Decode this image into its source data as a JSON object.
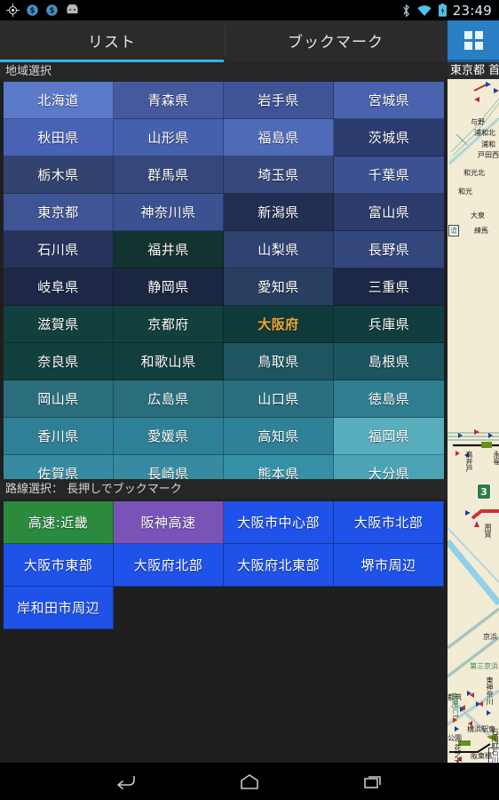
{
  "statusbar": {
    "time": "23:49",
    "left_icons": [
      "gps-crosshair-icon",
      "currency-dollar-icon",
      "currency-dollar-icon",
      "android-robot-icon"
    ],
    "right_icons": [
      "bluetooth-icon",
      "wifi-icon",
      "battery-charging-icon"
    ]
  },
  "tabs": [
    {
      "label": "リスト",
      "active": true
    },
    {
      "label": "ブックマーク",
      "active": false
    }
  ],
  "toolbar": {
    "grid_view_icon": "grid-view-icon",
    "accent": "#33b5e5",
    "button_bg": "#2a7fc4"
  },
  "region_section": {
    "label": "地域選択"
  },
  "route_section": {
    "label": "路線選択： 長押しでブックマーク"
  },
  "prefectures": [
    {
      "label": "北海道",
      "bg": "#5b79c9"
    },
    {
      "label": "青森県",
      "bg": "#44599e"
    },
    {
      "label": "岩手県",
      "bg": "#3f5496"
    },
    {
      "label": "宮城県",
      "bg": "#4a63ae"
    },
    {
      "label": "秋田県",
      "bg": "#4863b4"
    },
    {
      "label": "山形県",
      "bg": "#4561ad"
    },
    {
      "label": "福島県",
      "bg": "#4f6bb8"
    },
    {
      "label": "茨城県",
      "bg": "#2c3c6e"
    },
    {
      "label": "栃木県",
      "bg": "#33436f"
    },
    {
      "label": "群馬県",
      "bg": "#35477b"
    },
    {
      "label": "埼玉県",
      "bg": "#36487c"
    },
    {
      "label": "千葉県",
      "bg": "#3b5192"
    },
    {
      "label": "東京都",
      "bg": "#3e5494"
    },
    {
      "label": "神奈川県",
      "bg": "#3b5190"
    },
    {
      "label": "新潟県",
      "bg": "#232f52"
    },
    {
      "label": "富山県",
      "bg": "#2d3c6c"
    },
    {
      "label": "石川県",
      "bg": "#27335a"
    },
    {
      "label": "福井県",
      "bg": "#12332f"
    },
    {
      "label": "山梨県",
      "bg": "#2f4271"
    },
    {
      "label": "長野県",
      "bg": "#33477d"
    },
    {
      "label": "岐阜県",
      "bg": "#1e2746"
    },
    {
      "label": "静岡県",
      "bg": "#1b2640"
    },
    {
      "label": "愛知県",
      "bg": "#283f62"
    },
    {
      "label": "三重県",
      "bg": "#1d2746"
    },
    {
      "label": "滋賀県",
      "bg": "#12403f"
    },
    {
      "label": "京都府",
      "bg": "#11403e"
    },
    {
      "label": "大阪府",
      "bg": "#0f3a3a",
      "selected": true
    },
    {
      "label": "兵庫県",
      "bg": "#123d3e"
    },
    {
      "label": "奈良県",
      "bg": "#11403f"
    },
    {
      "label": "和歌山県",
      "bg": "#123f3d"
    },
    {
      "label": "鳥取県",
      "bg": "#1d5660"
    },
    {
      "label": "島根県",
      "bg": "#1b5560"
    },
    {
      "label": "岡山県",
      "bg": "#2b6e7d"
    },
    {
      "label": "広島県",
      "bg": "#2a6e7e"
    },
    {
      "label": "山口県",
      "bg": "#2a6f80"
    },
    {
      "label": "徳島県",
      "bg": "#2f7e90"
    },
    {
      "label": "香川県",
      "bg": "#2f8096"
    },
    {
      "label": "愛媛県",
      "bg": "#2e8096"
    },
    {
      "label": "高知県",
      "bg": "#2e8197"
    },
    {
      "label": "福岡県",
      "bg": "#59aebd"
    },
    {
      "label": "佐賀県",
      "bg": "#368ba0"
    },
    {
      "label": "長崎県",
      "bg": "#368ba0"
    },
    {
      "label": "熊本県",
      "bg": "#3590a5"
    },
    {
      "label": "大分県",
      "bg": "#4ba4b6"
    }
  ],
  "routes": [
    {
      "label": "高速:近畿",
      "bg": "#2b8a3e"
    },
    {
      "label": "阪神高速",
      "bg": "#7a53b8"
    },
    {
      "label": "大阪市中心部",
      "bg": "#1f52e8"
    },
    {
      "label": "大阪市北部",
      "bg": "#1f52e8"
    },
    {
      "label": "大阪市東部",
      "bg": "#1f52e8"
    },
    {
      "label": "大阪府北部",
      "bg": "#1f52e8"
    },
    {
      "label": "大阪府北東部",
      "bg": "#1f52e8"
    },
    {
      "label": "堺市周辺",
      "bg": "#1f52e8"
    },
    {
      "label": "岸和田市周辺",
      "bg": "#1f52e8"
    }
  ],
  "map_panel": {
    "title": "東京都 首",
    "route_shield": "3",
    "labels": [
      "与野",
      "浦和北",
      "浦和",
      "戸田西",
      "和光北",
      "和光",
      "大泉",
      "練馬",
      "高井戸",
      "永福",
      "用賀",
      "京浜",
      "第三京浜",
      "都筑",
      "東神奈川",
      "金港JCT",
      "横浜駅東",
      "石川町",
      "石川町JCT",
      "阪東橋",
      "花之木",
      "公園"
    ]
  },
  "navbar": {
    "buttons": [
      {
        "icon": "back-arrow-icon"
      },
      {
        "icon": "home-icon"
      },
      {
        "icon": "recent-apps-icon"
      }
    ]
  }
}
